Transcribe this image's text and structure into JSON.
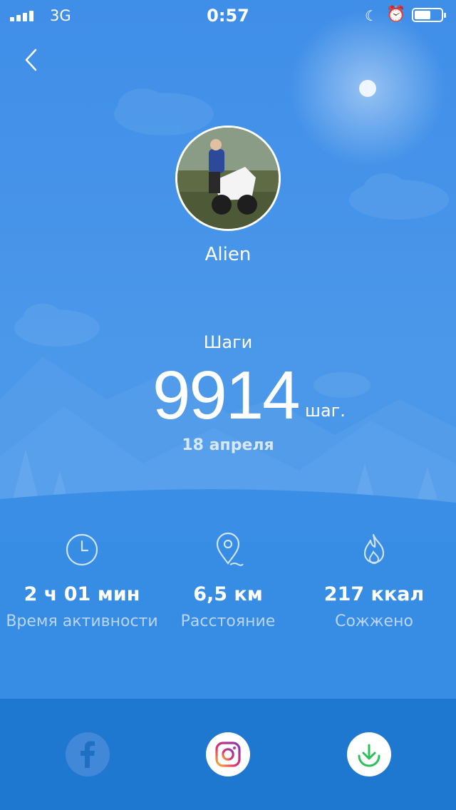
{
  "status_bar": {
    "network": "3G",
    "time": "0:57",
    "battery_level": 0.6
  },
  "profile": {
    "name": "Alien"
  },
  "steps": {
    "label": "Шаги",
    "value": "9914",
    "unit": "шаг.",
    "date": "18 апреля"
  },
  "stats": [
    {
      "icon": "clock-icon",
      "value": "2 ч 01 мин",
      "label": "Время активности"
    },
    {
      "icon": "location-pin-icon",
      "value": "6,5 км",
      "label": "Расстояние"
    },
    {
      "icon": "flame-icon",
      "value": "217 ккал",
      "label": "Сожжено"
    }
  ],
  "share": {
    "facebook": "facebook-icon",
    "instagram": "instagram-icon",
    "download": "download-icon"
  },
  "colors": {
    "sky_top": "#3f8ee8",
    "ground": "#2a7fd9",
    "bottom_bar": "#1f78cf",
    "download_green": "#2fbf5a"
  }
}
